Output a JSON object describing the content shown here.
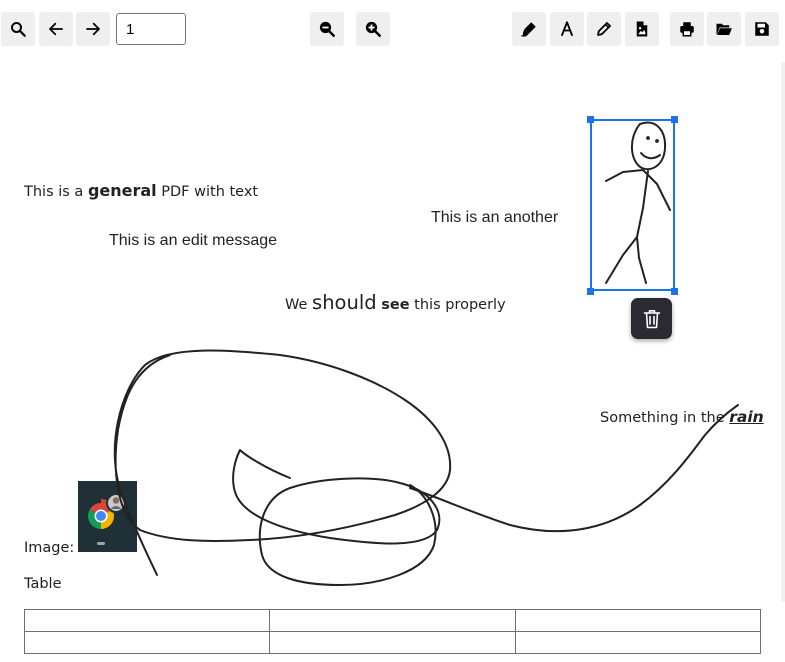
{
  "toolbar": {
    "left": [
      "search-icon",
      "arrow-left-icon",
      "arrow-right-icon"
    ],
    "page_number": "1",
    "zoom": [
      "zoom-out-icon",
      "zoom-in-icon"
    ],
    "tools": [
      "highlighter-icon",
      "text-icon",
      "pencil-icon",
      "file-image-icon"
    ],
    "file": [
      "print-icon",
      "folder-open-icon",
      "save-icon"
    ]
  },
  "document": {
    "line1": {
      "pre": "This is a ",
      "bold": "general",
      "post": " PDF with text"
    },
    "another": "This is an another",
    "edit_message": "This is an edit message",
    "should_line": {
      "pre": "We ",
      "big": "should",
      "mid": " ",
      "bold": "see",
      "post": " this properly"
    },
    "rain_line": {
      "pre": "Something in the ",
      "bold_italic": "rain"
    },
    "image_label": "Image:",
    "table_label": "Table",
    "table": {
      "rows": [
        [
          "",
          "",
          ""
        ],
        [
          "",
          "",
          ""
        ]
      ]
    }
  },
  "annotation": {
    "delete_icon": "trash-icon",
    "accent_color": "#1a73e8",
    "delete_bg": "#2b2a33"
  }
}
